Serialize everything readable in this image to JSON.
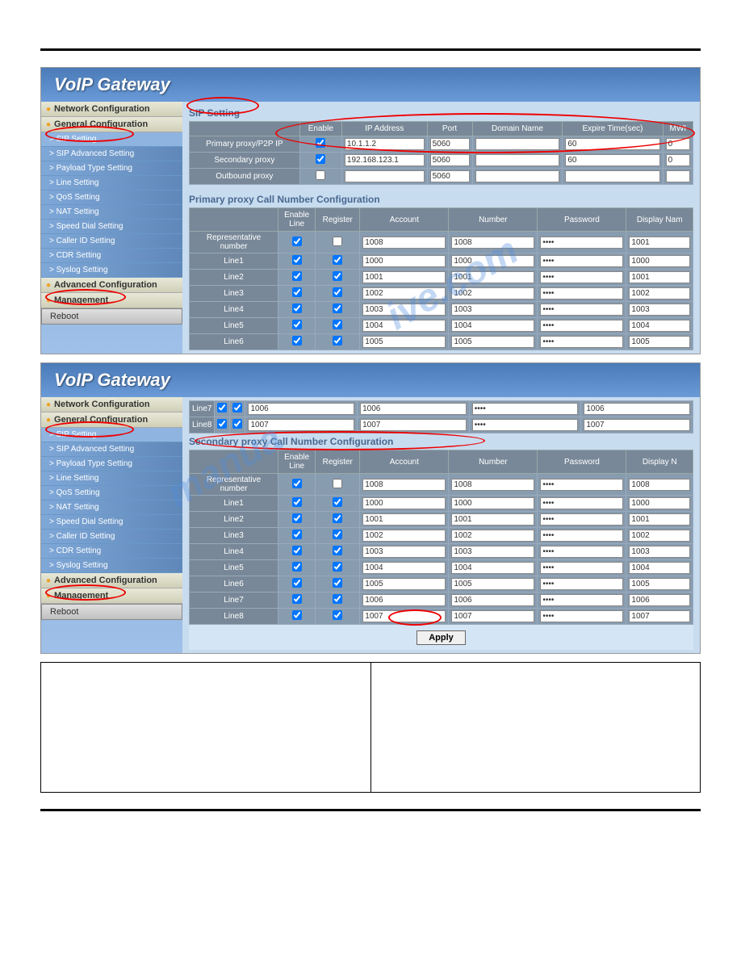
{
  "app_title": "VoIP Gateway",
  "nav": {
    "network_config": "Network Configuration",
    "general_config": "General Configuration",
    "items": [
      "> SIP Setting",
      "> SIP Advanced Setting",
      "> Payload Type Setting",
      "> Line Setting",
      "> QoS Setting",
      "> NAT Setting",
      "> Speed Dial Setting",
      "> Caller ID Setting",
      "> CDR Setting",
      "> Syslog Setting"
    ],
    "advanced_config": "Advanced Configuration",
    "management": "Management",
    "reboot": "Reboot"
  },
  "sip": {
    "title": "SIP Setting",
    "headers": [
      "",
      "Enable",
      "IP Address",
      "Port",
      "Domain Name",
      "Expire Time(sec)",
      "MWI"
    ],
    "rows": [
      {
        "label": "Primary proxy/P2P IP",
        "enable": true,
        "ip": "10.1.1.2",
        "port": "5060",
        "domain": "",
        "expire": "60",
        "mwi": "0"
      },
      {
        "label": "Secondary proxy",
        "enable": true,
        "ip": "192.168.123.1",
        "port": "5060",
        "domain": "",
        "expire": "60",
        "mwi": "0"
      },
      {
        "label": "Outbound proxy",
        "enable": false,
        "ip": "",
        "port": "5060",
        "domain": "",
        "expire": "",
        "mwi": ""
      }
    ]
  },
  "primary_call": {
    "title": "Primary proxy Call Number Configuration",
    "headers": [
      "",
      "Enable Line",
      "Register",
      "Account",
      "Number",
      "Password",
      "Display Nam"
    ],
    "rows": [
      {
        "label": "Representative number",
        "enable": true,
        "register": false,
        "account": "1008",
        "number": "1008",
        "password": "••••",
        "display": "1001"
      },
      {
        "label": "Line1",
        "enable": true,
        "register": true,
        "account": "1000",
        "number": "1000",
        "password": "••••",
        "display": "1000"
      },
      {
        "label": "Line2",
        "enable": true,
        "register": true,
        "account": "1001",
        "number": "1001",
        "password": "••••",
        "display": "1001"
      },
      {
        "label": "Line3",
        "enable": true,
        "register": true,
        "account": "1002",
        "number": "1002",
        "password": "••••",
        "display": "1002"
      },
      {
        "label": "Line4",
        "enable": true,
        "register": true,
        "account": "1003",
        "number": "1003",
        "password": "••••",
        "display": "1003"
      },
      {
        "label": "Line5",
        "enable": true,
        "register": true,
        "account": "1004",
        "number": "1004",
        "password": "••••",
        "display": "1004"
      },
      {
        "label": "Line6",
        "enable": true,
        "register": true,
        "account": "1005",
        "number": "1005",
        "password": "••••",
        "display": "1005"
      }
    ]
  },
  "top_rows2": [
    {
      "label": "Line7",
      "enable": true,
      "register": true,
      "account": "1006",
      "number": "1006",
      "password": "••••",
      "display": "1006"
    },
    {
      "label": "Line8",
      "enable": true,
      "register": true,
      "account": "1007",
      "number": "1007",
      "password": "••••",
      "display": "1007"
    }
  ],
  "secondary_call": {
    "title": "Secondary proxy Call Number Configuration",
    "headers": [
      "",
      "Enable Line",
      "Register",
      "Account",
      "Number",
      "Password",
      "Display N"
    ],
    "rows": [
      {
        "label": "Representative number",
        "enable": true,
        "register": false,
        "account": "1008",
        "number": "1008",
        "password": "••••",
        "display": "1008"
      },
      {
        "label": "Line1",
        "enable": true,
        "register": true,
        "account": "1000",
        "number": "1000",
        "password": "••••",
        "display": "1000"
      },
      {
        "label": "Line2",
        "enable": true,
        "register": true,
        "account": "1001",
        "number": "1001",
        "password": "••••",
        "display": "1001"
      },
      {
        "label": "Line3",
        "enable": true,
        "register": true,
        "account": "1002",
        "number": "1002",
        "password": "••••",
        "display": "1002"
      },
      {
        "label": "Line4",
        "enable": true,
        "register": true,
        "account": "1003",
        "number": "1003",
        "password": "••••",
        "display": "1003"
      },
      {
        "label": "Line5",
        "enable": true,
        "register": true,
        "account": "1004",
        "number": "1004",
        "password": "••••",
        "display": "1004"
      },
      {
        "label": "Line6",
        "enable": true,
        "register": true,
        "account": "1005",
        "number": "1005",
        "password": "••••",
        "display": "1005"
      },
      {
        "label": "Line7",
        "enable": true,
        "register": true,
        "account": "1006",
        "number": "1006",
        "password": "••••",
        "display": "1006"
      },
      {
        "label": "Line8",
        "enable": true,
        "register": true,
        "account": "1007",
        "number": "1007",
        "password": "••••",
        "display": "1007"
      }
    ]
  },
  "apply": "Apply",
  "watermark": "manualsarchive.com"
}
